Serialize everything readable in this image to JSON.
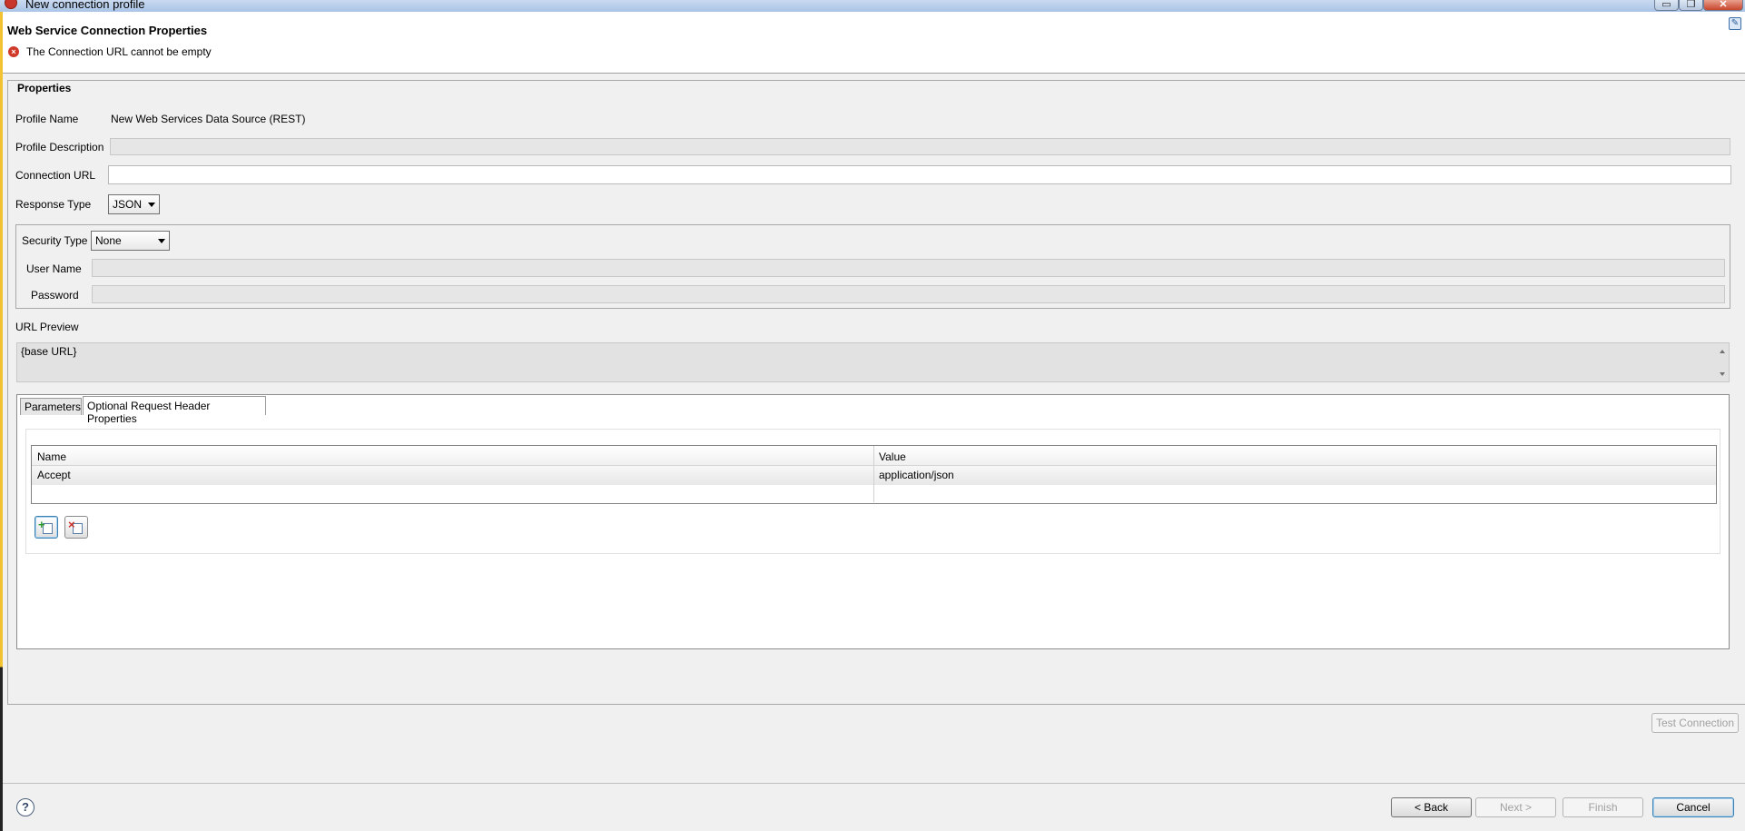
{
  "window": {
    "title": "New connection profile",
    "minimize_icon": "minimize-glyph",
    "maximize_icon": "maximize-glyph",
    "close_icon": "close-glyph",
    "controls": {
      "minimize": "▭",
      "maximize": "❐",
      "close": "✕"
    }
  },
  "header": {
    "title": "Web Service Connection Properties",
    "error_message": "The Connection URL cannot be empty",
    "error_icon": "error-icon"
  },
  "properties": {
    "group_title": "Properties",
    "profile_name_label": "Profile Name",
    "profile_name_value": "New Web Services Data Source (REST)",
    "profile_description_label": "Profile Description",
    "profile_description_value": "",
    "connection_url_label": "Connection URL",
    "connection_url_value": "",
    "response_type_label": "Response Type",
    "response_type_value": "JSON"
  },
  "security": {
    "security_type_label": "Security Type",
    "security_type_value": "None",
    "user_name_label": "User Name",
    "user_name_value": "",
    "password_label": "Password",
    "password_value": ""
  },
  "url_preview": {
    "label": "URL Preview",
    "value": "{base URL}"
  },
  "tabs": [
    {
      "label": "Parameters",
      "active": false
    },
    {
      "label": "Optional Request Header Properties",
      "active": true
    }
  ],
  "headers_table": {
    "columns": [
      "Name",
      "Value"
    ],
    "rows": [
      {
        "name": "Accept",
        "value": "application/json"
      }
    ],
    "add_icon": "add-row-icon",
    "remove_icon": "remove-row-icon"
  },
  "buttons": {
    "test_connection": "Test Connection",
    "back": "< Back",
    "next": "Next >",
    "finish": "Finish",
    "cancel": "Cancel",
    "help": "?"
  },
  "colors": {
    "error": "#d03a2a",
    "accent": "#3c7fb1"
  }
}
